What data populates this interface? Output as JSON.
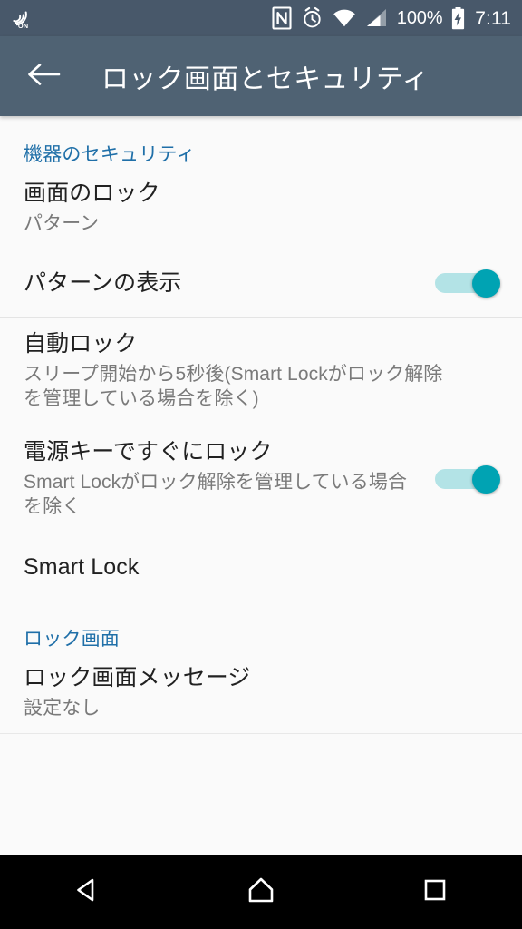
{
  "statusbar": {
    "nfc_on_label": "ON",
    "battery_percent": "100%",
    "clock": "7:11",
    "icons": [
      "nfc-on-icon",
      "nfc-icon",
      "alarm-icon",
      "wifi-icon",
      "signal-icon",
      "battery-charging-icon"
    ]
  },
  "toolbar": {
    "back_icon": "back-arrow-icon",
    "title": "ロック画面とセキュリティ"
  },
  "sections": [
    {
      "header": "機器のセキュリティ",
      "items": [
        {
          "title": "画面のロック",
          "subtitle": "パターン",
          "control": "none"
        },
        {
          "title": "パターンの表示",
          "subtitle": "",
          "control": "switch",
          "checked": true
        },
        {
          "title": "自動ロック",
          "subtitle": "スリープ開始から5秒後(Smart Lockがロック解除を管理している場合を除く)",
          "control": "none"
        },
        {
          "title": "電源キーですぐにロック",
          "subtitle": "Smart Lockがロック解除を管理している場合を除く",
          "control": "switch",
          "checked": true
        },
        {
          "title": "Smart Lock",
          "subtitle": "",
          "control": "none"
        }
      ]
    },
    {
      "header": "ロック画面",
      "items": [
        {
          "title": "ロック画面メッセージ",
          "subtitle": "設定なし",
          "control": "none"
        }
      ]
    }
  ],
  "navbar": {
    "back": "nav-back-icon",
    "home": "nav-home-icon",
    "recents": "nav-recents-icon"
  },
  "colors": {
    "statusbar_bg": "#48586a",
    "toolbar_bg": "#4f6273",
    "section_header": "#1f6fa8",
    "switch_on": "#00a3b3",
    "switch_track": "#b3e3e6",
    "content_bg": "#fafafa"
  }
}
